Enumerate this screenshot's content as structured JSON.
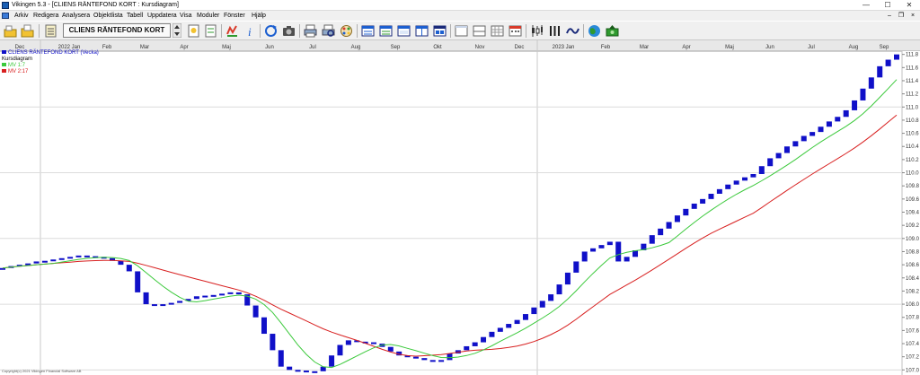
{
  "window": {
    "title": "Vikingen 5.3 - [CLIENS RÄNTEFOND KORT : Kursdiagram]",
    "minimize": "—",
    "maximize": "☐",
    "close": "✕"
  },
  "menu": {
    "items": [
      "Arkiv",
      "Redigera",
      "Analysera",
      "Objektlista",
      "Tabell",
      "Uppdatera",
      "Visa",
      "Moduler",
      "Fönster",
      "Hjälp"
    ],
    "mdi_minimize": "–",
    "mdi_restore": "❐",
    "mdi_close": "×"
  },
  "toolbar": {
    "fund_name": "CLIENS RÄNTEFOND KORT",
    "colors": {
      "blue": "#1c5fd0",
      "yellow": "#f2c230",
      "green": "#2f9a2f",
      "red": "#d83a2a",
      "gray": "#6a6a6a",
      "navy": "#1a2a7a"
    }
  },
  "chart": {
    "legend": {
      "series_name": "CLIENS RÄNTEFOND KORT (Vecka)",
      "chart_type": "Kursdiagram",
      "ma1_label": "MV 1:7",
      "ma2_label": "MV 2:17",
      "series_color": "#1010c8",
      "ma1_color": "#3bc93b",
      "ma2_color": "#d82020"
    },
    "copyright": "Copyright(c) 2021 Vikingen Financial Software AB"
  },
  "chart_data": {
    "type": "candlestick",
    "x_ticks": [
      "Dec",
      "2022 Jan",
      "Feb",
      "Mar",
      "Apr",
      "Maj",
      "Jun",
      "Jul",
      "Aug",
      "Sep",
      "Okt",
      "Nov",
      "Dec",
      "2023 Jan",
      "Feb",
      "Mar",
      "Apr",
      "Maj",
      "Jun",
      "Jul",
      "Aug",
      "Sep"
    ],
    "y_ticks": [
      "111.8",
      "111.6",
      "111.4",
      "111.2",
      "111.0",
      "110.8",
      "110.6",
      "110.4",
      "110.2",
      "110.0",
      "109.8",
      "109.6",
      "109.4",
      "109.2",
      "109.0",
      "108.8",
      "108.6",
      "108.4",
      "108.2",
      "108.0",
      "107.8",
      "107.6",
      "107.4",
      "107.2",
      "107.0"
    ],
    "ylim": [
      106.95,
      111.85
    ],
    "x_months": [
      0,
      1,
      2,
      3,
      4,
      5,
      6,
      7,
      8,
      9,
      10,
      11,
      12,
      13,
      14,
      15,
      16,
      17,
      18,
      19,
      20,
      21
    ],
    "weekly_close": [
      108.55,
      108.58,
      108.6,
      108.62,
      108.65,
      108.66,
      108.68,
      108.7,
      108.72,
      108.74,
      108.73,
      108.72,
      108.7,
      108.66,
      108.6,
      108.5,
      108.18,
      108.0,
      107.98,
      108.0,
      108.02,
      108.05,
      108.08,
      108.12,
      108.13,
      108.14,
      108.16,
      108.18,
      108.15,
      107.98,
      107.8,
      107.55,
      107.3,
      107.05,
      107.0,
      106.99,
      106.97,
      106.98,
      107.05,
      107.22,
      107.38,
      107.45,
      107.43,
      107.42,
      107.4,
      107.35,
      107.28,
      107.22,
      107.2,
      107.18,
      107.15,
      107.14,
      107.15,
      107.25,
      107.3,
      107.36,
      107.42,
      107.5,
      107.58,
      107.64,
      107.7,
      107.76,
      107.85,
      107.95,
      108.05,
      108.15,
      108.3,
      108.48,
      108.65,
      108.8,
      108.85,
      108.9,
      108.95,
      108.65,
      108.72,
      108.82,
      108.92,
      109.05,
      109.15,
      109.25,
      109.35,
      109.45,
      109.53,
      109.6,
      109.68,
      109.75,
      109.82,
      109.88,
      109.93,
      109.98,
      110.1,
      110.22,
      110.3,
      110.4,
      110.48,
      110.56,
      110.62,
      110.7,
      110.78,
      110.85,
      110.95,
      111.1,
      111.28,
      111.45,
      111.62,
      111.72,
      111.8
    ],
    "ma1": {
      "name": "MV 1:7",
      "period": 7
    },
    "ma2": {
      "name": "MV 2:17",
      "period": 17
    }
  }
}
